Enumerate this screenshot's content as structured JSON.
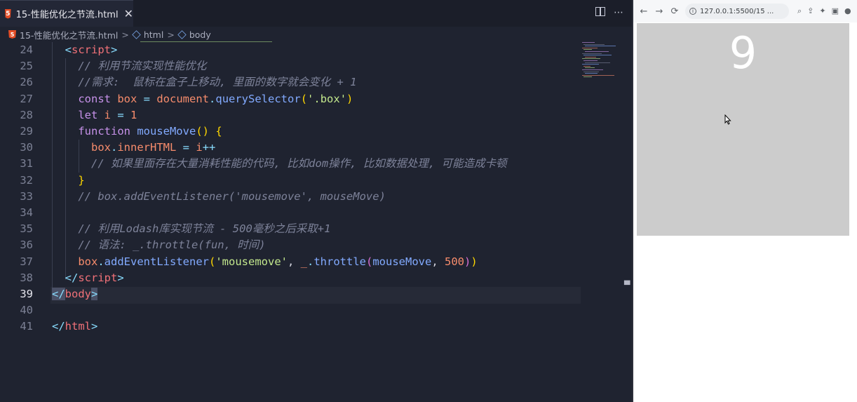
{
  "editor": {
    "tab_title": "15-性能优化之节流.html",
    "tab_close": "✕",
    "html_badge": "5",
    "actions": {
      "more": "⋯"
    },
    "breadcrumb": {
      "file": "15-性能优化之节流.html",
      "items": [
        "html",
        "body"
      ],
      "separator": ">"
    },
    "lines": [
      {
        "n": "24",
        "indent": "  ",
        "parts": [
          {
            "t": "<",
            "c": "br"
          },
          {
            "t": "script",
            "c": "tag"
          },
          {
            "t": ">",
            "c": "br"
          }
        ]
      },
      {
        "n": "25",
        "indent": "    ",
        "parts": [
          {
            "t": "// 利用节流实现性能优化",
            "c": "cm"
          }
        ]
      },
      {
        "n": "26",
        "indent": "    ",
        "parts": [
          {
            "t": "//需求:  鼠标在盒子上移动, 里面的数字就会变化 + 1",
            "c": "cm"
          }
        ]
      },
      {
        "n": "27",
        "indent": "    ",
        "parts": [
          {
            "t": "const",
            "c": "kw"
          },
          {
            "t": " box ",
            "c": "var"
          },
          {
            "t": "=",
            "c": "op"
          },
          {
            "t": " document",
            "c": "var"
          },
          {
            "t": ".",
            "c": "op"
          },
          {
            "t": "querySelector",
            "c": "fn"
          },
          {
            "t": "(",
            "c": "bp"
          },
          {
            "t": "'.box'",
            "c": "str"
          },
          {
            "t": ")",
            "c": "bp"
          }
        ]
      },
      {
        "n": "28",
        "indent": "    ",
        "parts": [
          {
            "t": "let",
            "c": "kw"
          },
          {
            "t": " i ",
            "c": "var"
          },
          {
            "t": "=",
            "c": "op"
          },
          {
            "t": " 1",
            "c": "num"
          }
        ]
      },
      {
        "n": "29",
        "indent": "    ",
        "parts": [
          {
            "t": "function",
            "c": "kw"
          },
          {
            "t": " mouseMove",
            "c": "fn"
          },
          {
            "t": "()",
            "c": "bp"
          },
          {
            "t": " {",
            "c": "bp"
          }
        ]
      },
      {
        "n": "30",
        "indent": "      ",
        "parts": [
          {
            "t": "box",
            "c": "var"
          },
          {
            "t": ".",
            "c": "op"
          },
          {
            "t": "innerHTML",
            "c": "var"
          },
          {
            "t": " = ",
            "c": "op"
          },
          {
            "t": "i",
            "c": "var"
          },
          {
            "t": "++",
            "c": "op"
          }
        ]
      },
      {
        "n": "31",
        "indent": "      ",
        "parts": [
          {
            "t": "// 如果里面存在大量消耗性能的代码, 比如dom操作, 比如数据处理, 可能造成卡顿",
            "c": "cm"
          }
        ]
      },
      {
        "n": "32",
        "indent": "    ",
        "parts": [
          {
            "t": "}",
            "c": "bp"
          }
        ]
      },
      {
        "n": "33",
        "indent": "    ",
        "parts": [
          {
            "t": "// box.addEventListener('mousemove', mouseMove)",
            "c": "cm"
          }
        ]
      },
      {
        "n": "34",
        "indent": "",
        "parts": []
      },
      {
        "n": "35",
        "indent": "    ",
        "parts": [
          {
            "t": "// 利用Lodash库实现节流 - 500毫秒之后采取+1",
            "c": "cm"
          }
        ]
      },
      {
        "n": "36",
        "indent": "    ",
        "parts": [
          {
            "t": "// 语法: _.throttle(fun, 时间)",
            "c": "cm"
          }
        ]
      },
      {
        "n": "37",
        "indent": "    ",
        "parts": [
          {
            "t": "box",
            "c": "var"
          },
          {
            "t": ".",
            "c": "op"
          },
          {
            "t": "addEventListener",
            "c": "fn"
          },
          {
            "t": "(",
            "c": "bp"
          },
          {
            "t": "'mousemove'",
            "c": "str"
          },
          {
            "t": ", ",
            "c": "pn"
          },
          {
            "t": "_",
            "c": "var"
          },
          {
            "t": ".",
            "c": "op"
          },
          {
            "t": "throttle",
            "c": "fn"
          },
          {
            "t": "(",
            "c": "bp2"
          },
          {
            "t": "mouseMove",
            "c": "fn"
          },
          {
            "t": ", ",
            "c": "pn"
          },
          {
            "t": "500",
            "c": "num"
          },
          {
            "t": ")",
            "c": "bp2"
          },
          {
            "t": ")",
            "c": "bp"
          }
        ]
      },
      {
        "n": "38",
        "indent": "  ",
        "parts": [
          {
            "t": "</",
            "c": "br"
          },
          {
            "t": "script",
            "c": "tag"
          },
          {
            "t": ">",
            "c": "br"
          }
        ]
      },
      {
        "n": "39",
        "indent": "",
        "active": true,
        "parts": [
          {
            "t": "</",
            "c": "br hl"
          },
          {
            "t": "body",
            "c": "tag"
          },
          {
            "t": ">",
            "c": "br hl"
          }
        ]
      },
      {
        "n": "40",
        "indent": "",
        "parts": []
      },
      {
        "n": "41",
        "indent": "",
        "parts": [
          {
            "t": "</",
            "c": "br"
          },
          {
            "t": "html",
            "c": "tag"
          },
          {
            "t": ">",
            "c": "br"
          }
        ]
      }
    ]
  },
  "browser": {
    "url": "127.0.0.1:5500/15 ...",
    "nav": {
      "back": "←",
      "forward": "→",
      "reload": "⟳"
    },
    "box_value": "9",
    "colors": {
      "box": "#cccccc",
      "box_text": "#ffffff"
    }
  }
}
